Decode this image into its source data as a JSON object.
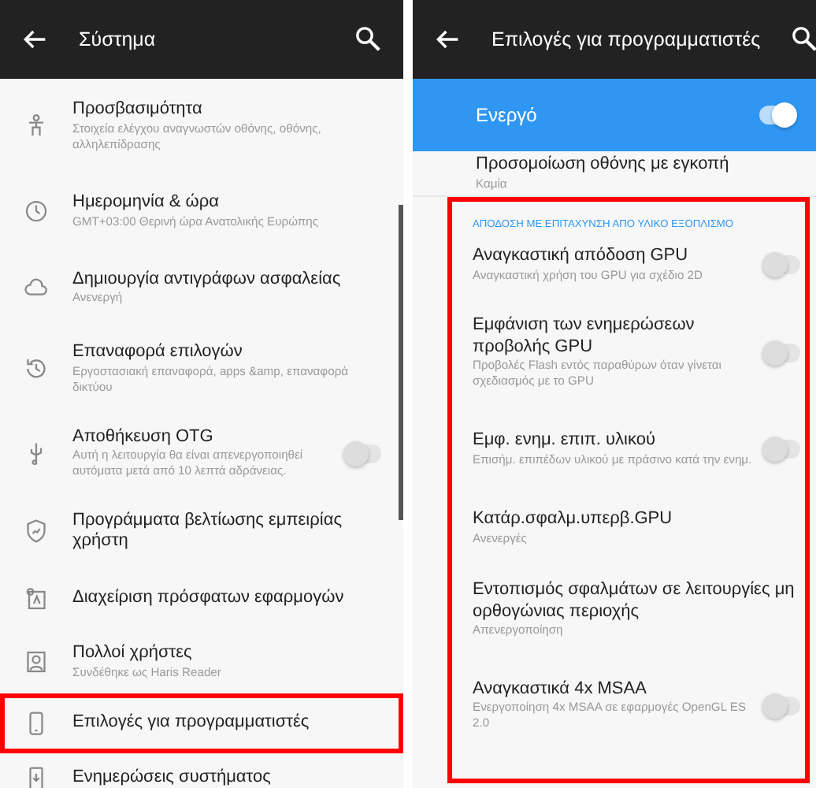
{
  "left": {
    "header": {
      "title": "Σύστημα"
    },
    "items": [
      {
        "title": "Προσβασιμότητα",
        "subtitle": "Στοιχεία ελέγχου αναγνωστών οθόνης, οθόνης, αλληλεπίδρασης",
        "kind": "plain",
        "highlighted": false
      },
      {
        "title": "Ημερομηνία & ώρα",
        "subtitle": "GMT+03:00 Θερινή ώρα Ανατολικής Ευρώπης",
        "kind": "plain",
        "highlighted": false
      },
      {
        "title": "Δημιουργία αντιγράφων ασφαλείας",
        "subtitle": "Ανενεργή",
        "kind": "plain",
        "highlighted": false
      },
      {
        "title": "Επαναφορά επιλογών",
        "subtitle": "Εργοστασιακή επαναφορά, apps &amp, επαναφορά δικτύου",
        "kind": "plain",
        "highlighted": false
      },
      {
        "title": "Αποθήκευση OTG",
        "subtitle": "Αυτή η λειτουργία θα είναι απενεργοποιηθεί αυτόματα μετά από 10 λεπτά αδράνειας.",
        "kind": "toggle",
        "on": false,
        "highlighted": false
      },
      {
        "title": "Προγράμματα βελτίωσης εμπειρίας χρήστη",
        "kind": "plain",
        "highlighted": false
      },
      {
        "title": "Διαχείριση πρόσφατων εφαρμογών",
        "kind": "plain",
        "highlighted": false
      },
      {
        "title": "Πολλοί χρήστες",
        "subtitle": "Συνδέθηκε ως Haris Reader",
        "kind": "plain",
        "highlighted": false
      },
      {
        "title": "Επιλογές για προγραμματιστές",
        "kind": "plain",
        "highlighted": true
      },
      {
        "title": "Ενημερώσεις συστήματος",
        "kind": "plain",
        "highlighted": false
      }
    ]
  },
  "right": {
    "header": {
      "title": "Επιλογές για προγραμματιστές"
    },
    "master": {
      "label": "Ενεργό",
      "on": true
    },
    "partial_item": {
      "title": "Προσομοίωση οθόνης με εγκοπή",
      "subtitle": "Καμία"
    },
    "section": {
      "title": "ΑΠΟΔΟΣΗ ΜΕ ΕΠΙΤΑΧΥΝΣΗ ΑΠΟ ΥΛΙΚΟ ΕΞΟΠΛΙΣΜΟ",
      "highlighted": true
    },
    "items": [
      {
        "title": "Αναγκαστική απόδοση GPU",
        "subtitle": "Αναγκαστική χρήση του GPU για σχέδιο 2D",
        "kind": "toggle",
        "on": false
      },
      {
        "title": "Εμφάνιση των ενημερώσεων προβολής GPU",
        "subtitle": "Προβολές Flash εντός παραθύρων όταν γίνεται σχεδιασμός με το GPU",
        "kind": "toggle",
        "on": false
      },
      {
        "title": "Εμφ. ενημ. επιπ. υλικού",
        "subtitle": "Επισήμ. επιπέδων υλικού με πράσινο κατά την ενημ.",
        "kind": "toggle",
        "on": false
      },
      {
        "title": "Κατάρ.σφαλμ.υπερβ.GPU",
        "subtitle": "Ανενεργές",
        "kind": "plain"
      },
      {
        "title": "Εντοπισμός σφαλμάτων σε λειτουργίες μη ορθογώνιας περιοχής",
        "subtitle": "Απενεργοποίηση",
        "kind": "plain"
      },
      {
        "title": "Αναγκαστικά 4x MSAA",
        "subtitle": "Ενεργοποίηση 4x MSAA σε εφαρμογές OpenGL ES 2.0",
        "kind": "toggle",
        "on": false
      }
    ]
  }
}
